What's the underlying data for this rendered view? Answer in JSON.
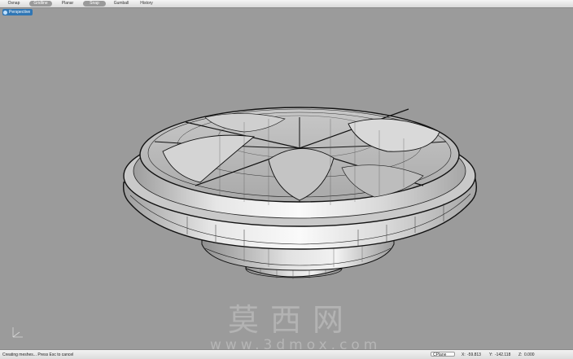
{
  "toolbar": {
    "items": [
      {
        "label": "Osnap",
        "active": false
      },
      {
        "label": "Gridline",
        "active": true
      },
      {
        "label": "Planar",
        "active": false
      },
      {
        "label": "Snap",
        "active": true
      },
      {
        "label": "Gumball",
        "active": false
      },
      {
        "label": "History",
        "active": false
      }
    ]
  },
  "viewport": {
    "label": "Perspective",
    "background": "#9b9b9b"
  },
  "watermark": {
    "chinese": "莫西网",
    "url": "www.3dmox.com"
  },
  "statusbar": {
    "message": "Creating meshes... Press Esc to cancel",
    "cplane": "CPlane",
    "x_label": "X:",
    "x_value": "-59.813",
    "y_label": "Y:",
    "y_value": "-142.118",
    "z_label": "Z:",
    "z_value": "0.000"
  },
  "colors": {
    "accent": "#2f76b5",
    "toggle_on": "#9a9a9a"
  }
}
